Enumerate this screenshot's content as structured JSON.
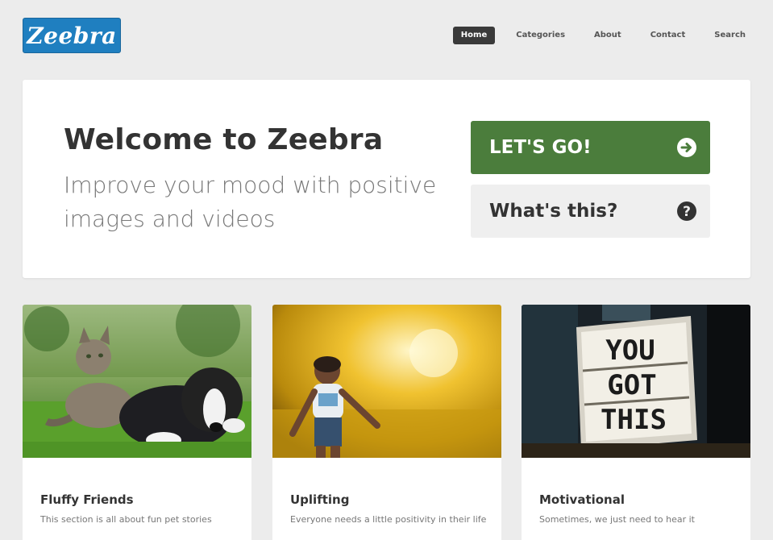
{
  "header": {
    "logo_text": "Zeebra",
    "nav": [
      {
        "label": "Home",
        "active": true
      },
      {
        "label": "Categories",
        "active": false
      },
      {
        "label": "About",
        "active": false
      },
      {
        "label": "Contact",
        "active": false
      },
      {
        "label": "Search",
        "active": false
      }
    ]
  },
  "hero": {
    "title": "Welcome to Zeebra",
    "subtitle": "Improve your mood with positive images and videos",
    "primary_button": {
      "label": "LET'S GO!",
      "icon": "arrow-right-circle-icon"
    },
    "secondary_button": {
      "label": "What's this?",
      "icon": "question-circle-icon"
    }
  },
  "cards": [
    {
      "title": "Fluffy Friends",
      "description": "This section is all about fun pet stories",
      "image": "cat-and-dog-photo"
    },
    {
      "title": "Uplifting",
      "description": "Everyone needs a little positivity in their life",
      "image": "child-in-sprinkler-photo"
    },
    {
      "title": "Motivational",
      "description": "Sometimes, we just need to hear it",
      "image": "lightbox-sign-photo",
      "image_text": [
        "YOU",
        "GOT",
        "THIS"
      ]
    }
  ],
  "colors": {
    "brand_blue": "#1f7fc0",
    "primary_green": "#4b7d3c",
    "nav_active": "#3a3a3a",
    "page_bg": "#ececec"
  }
}
